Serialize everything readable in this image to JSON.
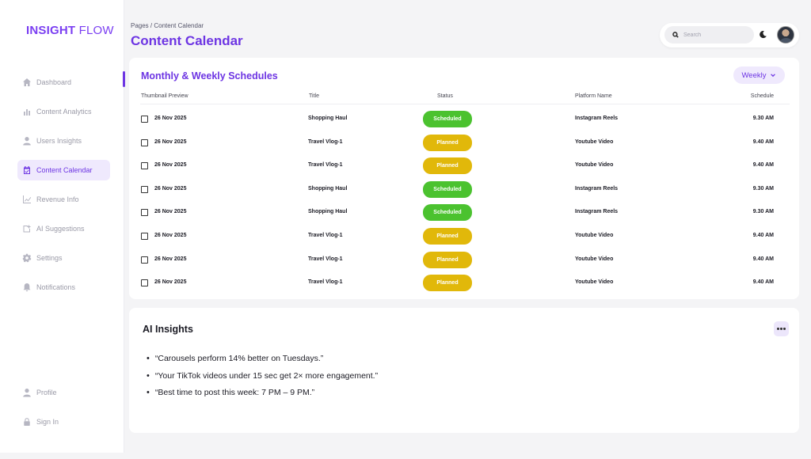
{
  "brand": {
    "name_bold": "INSIGHT",
    "name_light": "FLOW",
    "accent": "#6d35e3"
  },
  "sidebar": {
    "items": [
      {
        "label": "Dashboard",
        "icon": "home-icon"
      },
      {
        "label": "Content Analytics",
        "icon": "bar-chart-icon"
      },
      {
        "label": "Users Insights",
        "icon": "user-icon"
      },
      {
        "label": "Content Calendar",
        "icon": "calendar-icon",
        "active": true
      },
      {
        "label": "Revenue Info",
        "icon": "line-chart-icon"
      },
      {
        "label": "AI Suggestions",
        "icon": "ai-suggestion-icon"
      },
      {
        "label": "Settings",
        "icon": "gear-icon"
      },
      {
        "label": "Notifications",
        "icon": "bell-icon"
      }
    ],
    "bottom_items": [
      {
        "label": "Profile",
        "icon": "user-icon"
      },
      {
        "label": "Sign In",
        "icon": "lock-icon"
      }
    ]
  },
  "header": {
    "breadcrumb": "Pages / Content Calendar",
    "title": "Content Calendar",
    "search_placeholder": "Search"
  },
  "schedules": {
    "title": "Monthly & Weekly Schedules",
    "view_select": "Weekly",
    "columns": [
      "Thumbnail Preview",
      "Title",
      "Status",
      "Platform Name",
      "Schedule"
    ],
    "rows": [
      {
        "date": "26 Nov 2025",
        "title": "Shopping Haul",
        "status": "Scheduled",
        "platform": "Instagram Reels",
        "time": "9.30 AM"
      },
      {
        "date": "26 Nov 2025",
        "title": "Travel Vlog-1",
        "status": "Planned",
        "platform": "Youtube Video",
        "time": "9.40 AM"
      },
      {
        "date": "26 Nov 2025",
        "title": "Travel Vlog-1",
        "status": "Planned",
        "platform": "Youtube Video",
        "time": "9.40 AM"
      },
      {
        "date": "26 Nov 2025",
        "title": "Shopping Haul",
        "status": "Scheduled",
        "platform": "Instagram Reels",
        "time": "9.30 AM"
      },
      {
        "date": "26 Nov 2025",
        "title": "Shopping Haul",
        "status": "Scheduled",
        "platform": "Instagram Reels",
        "time": "9.30 AM"
      },
      {
        "date": "26 Nov 2025",
        "title": "Travel Vlog-1",
        "status": "Planned",
        "platform": "Youtube Video",
        "time": "9.40 AM"
      },
      {
        "date": "26 Nov 2025",
        "title": "Travel Vlog-1",
        "status": "Planned",
        "platform": "Youtube Video",
        "time": "9.40 AM"
      },
      {
        "date": "26 Nov 2025",
        "title": "Travel Vlog-1",
        "status": "Planned",
        "platform": "Youtube Video",
        "time": "9.40 AM"
      }
    ],
    "status_colors": {
      "Scheduled": "#4bc22f",
      "Planned": "#e1b80a"
    }
  },
  "insights": {
    "title": "AI Insights",
    "items": [
      "“Carousels perform 14% better on Tuesdays.”",
      "“Your TikTok videos under 15 sec get 2× more engagement.”",
      "“Best time to post this week: 7 PM – 9 PM.”"
    ]
  }
}
